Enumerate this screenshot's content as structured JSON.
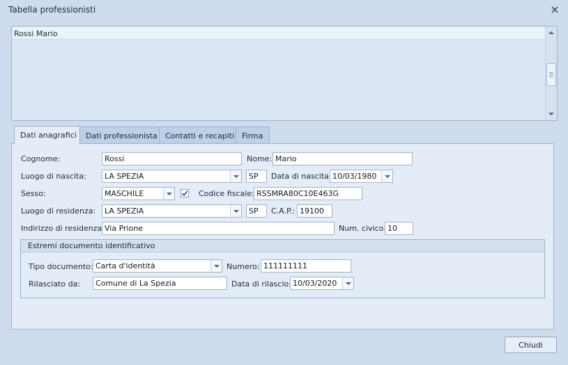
{
  "window": {
    "title": "Tabella professionisti"
  },
  "list": {
    "items": [
      "Rossi Mario"
    ]
  },
  "tabs": [
    {
      "label": "Dati anagrafici",
      "active": true
    },
    {
      "label": "Dati professionista",
      "active": false
    },
    {
      "label": "Contatti e recapiti",
      "active": false
    },
    {
      "label": "Firma",
      "active": false
    }
  ],
  "form": {
    "cognome": {
      "label": "Cognome:",
      "value": "Rossi"
    },
    "nome": {
      "label": "Nome:",
      "value": "Mario"
    },
    "luogo_nascita": {
      "label": "Luogo di nascita:",
      "value": "LA SPEZIA",
      "prov": "SP"
    },
    "data_nascita": {
      "label": "Data di nascita:",
      "value": "10/03/1980"
    },
    "sesso": {
      "label": "Sesso:",
      "value": "MASCHILE"
    },
    "codice_fiscale": {
      "label": "Codice fiscale:",
      "value": "RSSMRA80C10E463G",
      "checked": true
    },
    "luogo_residenza": {
      "label": "Luogo di residenza:",
      "value": "LA SPEZIA",
      "prov": "SP"
    },
    "cap": {
      "label": "C.A.P.:",
      "value": "19100"
    },
    "indirizzo": {
      "label": "Indirizzo di residenza:",
      "value": "Via Prione"
    },
    "num_civico": {
      "label": "Num. civico:",
      "value": "10"
    }
  },
  "documento": {
    "title": "Estremi documento identificativo",
    "tipo": {
      "label": "Tipo documento:",
      "value": "Carta d'identità"
    },
    "numero": {
      "label": "Numero:",
      "value": "111111111"
    },
    "rilasciato": {
      "label": "Rilasciato da:",
      "value": "Comune di La Spezia"
    },
    "data_rilascio": {
      "label": "Data di rilascio:",
      "value": "10/03/2020"
    }
  },
  "buttons": {
    "close": "Chiudi"
  },
  "icons": {
    "close": "close-x-icon",
    "dropdown": "chevron-down-icon",
    "check": "checkmark-icon"
  },
  "colors": {
    "background": "#cfdced",
    "panel": "#e3ecf7",
    "selection": "#eaf2fc",
    "border": "#9fb1c9"
  }
}
